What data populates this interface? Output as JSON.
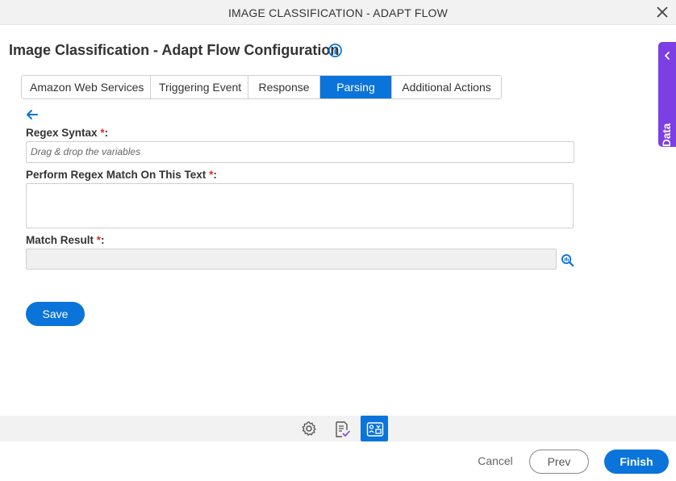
{
  "window": {
    "title": "IMAGE CLASSIFICATION - ADAPT FLOW"
  },
  "page": {
    "title": "Image Classification - Adapt Flow Configuration"
  },
  "tabs": [
    {
      "label": "Amazon Web Services",
      "active": false
    },
    {
      "label": "Triggering Event",
      "active": false
    },
    {
      "label": "Response",
      "active": false
    },
    {
      "label": "Parsing",
      "active": true
    },
    {
      "label": "Additional Actions",
      "active": false
    }
  ],
  "form": {
    "regex_syntax": {
      "label": "Regex Syntax",
      "required_marker": "*",
      "suffix": ":",
      "placeholder": "Drag & drop the variables",
      "value": ""
    },
    "regex_text": {
      "label": "Perform Regex Match On This Text",
      "required_marker": "*",
      "suffix": ":",
      "value": ""
    },
    "match_result": {
      "label": "Match Result",
      "required_marker": "*",
      "suffix": ":",
      "value": ""
    },
    "save_label": "Save"
  },
  "side_panel": {
    "label": "App Data"
  },
  "toolbar": {
    "icons": [
      "settings-icon",
      "checklist-icon",
      "app-data-mapping-icon"
    ],
    "active": "app-data-mapping-icon"
  },
  "footer": {
    "cancel_label": "Cancel",
    "prev_label": "Prev",
    "finish_label": "Finish"
  },
  "colors": {
    "accent": "#0a74da",
    "side_panel": "#7b3fe4",
    "required": "#d62d2d"
  }
}
